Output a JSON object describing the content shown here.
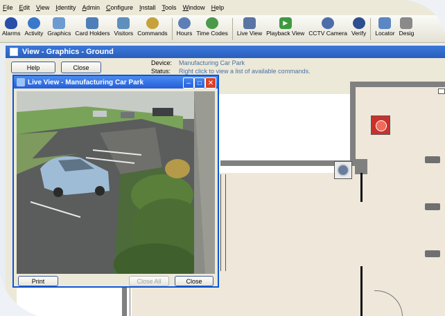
{
  "menu": [
    "File",
    "Edit",
    "View",
    "Identity",
    "Admin",
    "Configure",
    "Install",
    "Tools",
    "Window",
    "Help"
  ],
  "toolbar": [
    {
      "label": "Alarms",
      "icon": "alarm-bell-icon",
      "color": "#2a4fa8"
    },
    {
      "label": "Activity",
      "icon": "activity-eye-icon",
      "color": "#3a78c9"
    },
    {
      "label": "Graphics",
      "icon": "graphics-map-icon",
      "color": "#6b9bd1"
    },
    {
      "label": "Card Holders",
      "icon": "card-holders-icon",
      "color": "#4f7fb8"
    },
    {
      "label": "Visitors",
      "icon": "visitors-icon",
      "color": "#5f8fbd"
    },
    {
      "label": "Commands",
      "icon": "commands-icon",
      "color": "#c7a23a"
    },
    {
      "label": "Hours",
      "icon": "hours-clock-icon",
      "color": "#5d7fb5"
    },
    {
      "label": "Time Codes",
      "icon": "time-codes-icon",
      "color": "#4b9a4a"
    },
    {
      "label": "Live View",
      "icon": "live-view-icon",
      "color": "#5a74a3"
    },
    {
      "label": "Playback View",
      "icon": "playback-view-icon",
      "color": "#3f9a3f"
    },
    {
      "label": "CCTV Camera",
      "icon": "cctv-camera-icon",
      "color": "#4d6ea8"
    },
    {
      "label": "Verify",
      "icon": "verify-icon",
      "color": "#2d4f8f"
    },
    {
      "label": "Locator",
      "icon": "locator-icon",
      "color": "#5c86c4"
    },
    {
      "label": "Desig",
      "icon": "design-icon",
      "color": "#8a8a8a"
    }
  ],
  "view_window": {
    "title": "View - Graphics - Ground",
    "help_label": "Help",
    "close_label": "Close",
    "device_label": "Device:",
    "device_value": "Manufacturing Car Park",
    "status_label": "Status:",
    "status_value": "Right click to view a list of available commands."
  },
  "live_view": {
    "title": "Live View - Manufacturing Car Park",
    "print_label": "Print",
    "close_all_label": "Close All",
    "close_label": "Close"
  }
}
